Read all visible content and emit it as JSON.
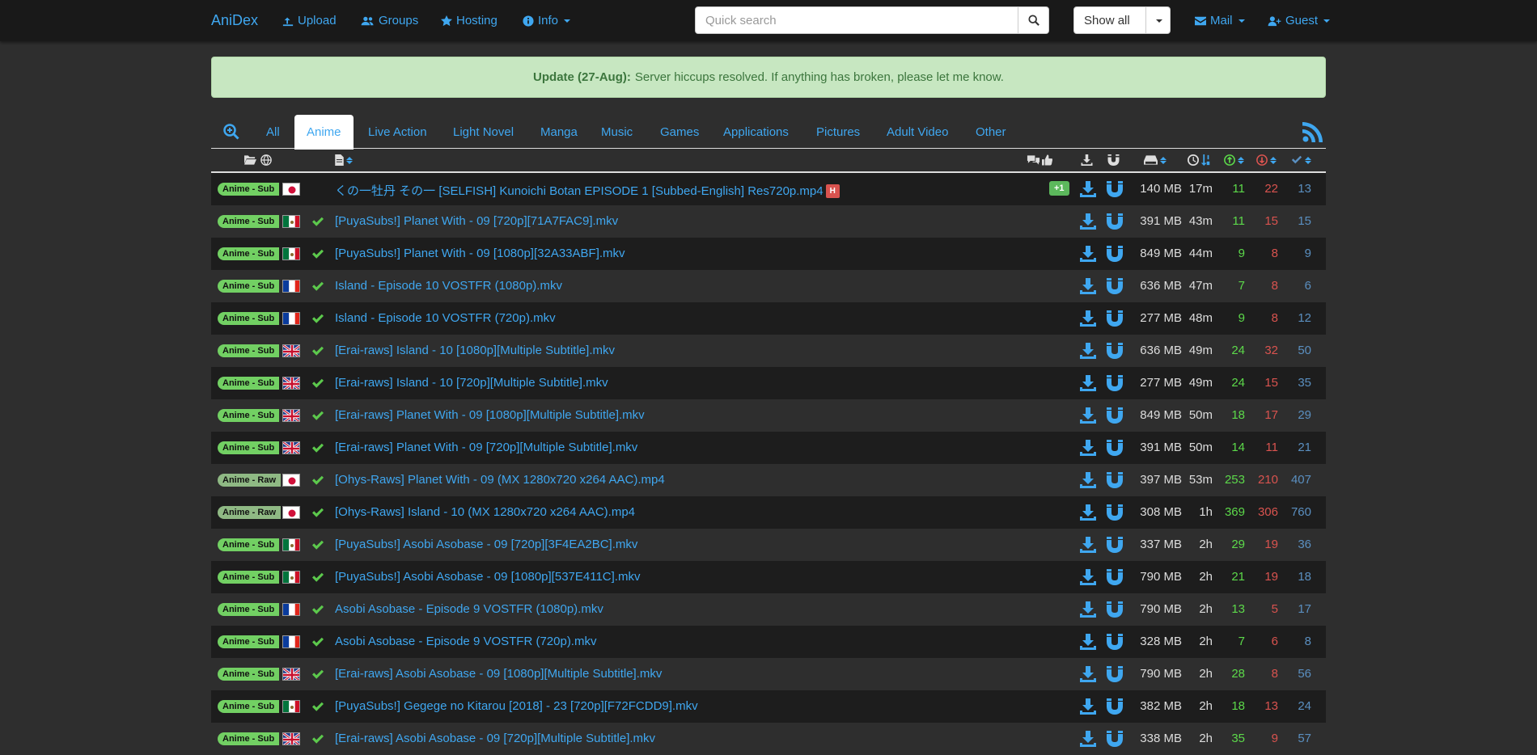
{
  "navbar": {
    "brand": "AniDex",
    "links": [
      {
        "label": "Upload",
        "icon": "upload-icon"
      },
      {
        "label": "Groups",
        "icon": "users-icon"
      },
      {
        "label": "Hosting",
        "icon": "star-icon"
      },
      {
        "label": "Info",
        "icon": "info-circle-icon"
      }
    ],
    "search_placeholder": "Quick search",
    "filter_label": "Show all",
    "mail_label": "Mail",
    "guest_label": "Guest"
  },
  "alert": {
    "title": "Update (27-Aug):",
    "message": "Server hiccups resolved. If anything has broken, please let me know."
  },
  "tabs": {
    "items": [
      "All",
      "Anime",
      "Live Action",
      "Light Novel",
      "Manga",
      "Music",
      "Games",
      "Applications",
      "Pictures",
      "Adult Video",
      "Other"
    ],
    "active": "Anime"
  },
  "rows": [
    {
      "cat": "Anime - Sub",
      "flag": "jp",
      "name": "くの一牡丹 その一 [SELFISH] Kunoichi Botan EPISODE 1 [Subbed-English] Res720p.mp4",
      "h": "H",
      "likes": "+1",
      "size": "140 MB",
      "age": "17m",
      "seed": "11",
      "leech": "22",
      "comp": "13"
    },
    {
      "cat": "Anime - Sub",
      "flag": "mx",
      "name": "[PuyaSubs!] Planet With - 09 [720p][71A7FAC9].mkv",
      "size": "391 MB",
      "age": "43m",
      "seed": "11",
      "leech": "15",
      "comp": "15"
    },
    {
      "cat": "Anime - Sub",
      "flag": "mx",
      "name": "[PuyaSubs!] Planet With - 09 [1080p][32A33ABF].mkv",
      "size": "849 MB",
      "age": "44m",
      "seed": "9",
      "leech": "8",
      "comp": "9"
    },
    {
      "cat": "Anime - Sub",
      "flag": "fr",
      "name": "Island - Episode 10 VOSTFR (1080p).mkv",
      "size": "636 MB",
      "age": "47m",
      "seed": "7",
      "leech": "8",
      "comp": "6"
    },
    {
      "cat": "Anime - Sub",
      "flag": "fr",
      "name": "Island - Episode 10 VOSTFR (720p).mkv",
      "size": "277 MB",
      "age": "48m",
      "seed": "9",
      "leech": "8",
      "comp": "12"
    },
    {
      "cat": "Anime - Sub",
      "flag": "gb",
      "name": "[Erai-raws] Island - 10 [1080p][Multiple Subtitle].mkv",
      "size": "636 MB",
      "age": "49m",
      "seed": "24",
      "leech": "32",
      "comp": "50"
    },
    {
      "cat": "Anime - Sub",
      "flag": "gb",
      "name": "[Erai-raws] Island - 10 [720p][Multiple Subtitle].mkv",
      "size": "277 MB",
      "age": "49m",
      "seed": "24",
      "leech": "15",
      "comp": "35"
    },
    {
      "cat": "Anime - Sub",
      "flag": "gb",
      "name": "[Erai-raws] Planet With - 09 [1080p][Multiple Subtitle].mkv",
      "size": "849 MB",
      "age": "50m",
      "seed": "18",
      "leech": "17",
      "comp": "29"
    },
    {
      "cat": "Anime - Sub",
      "flag": "gb",
      "name": "[Erai-raws] Planet With - 09 [720p][Multiple Subtitle].mkv",
      "size": "391 MB",
      "age": "50m",
      "seed": "14",
      "leech": "11",
      "comp": "21"
    },
    {
      "cat": "Anime - Raw",
      "flag": "jp",
      "name": "[Ohys-Raws] Planet With - 09 (MX 1280x720 x264 AAC).mp4",
      "size": "397 MB",
      "age": "53m",
      "seed": "253",
      "leech": "210",
      "comp": "407"
    },
    {
      "cat": "Anime - Raw",
      "flag": "jp",
      "name": "[Ohys-Raws] Island - 10 (MX 1280x720 x264 AAC).mp4",
      "size": "308 MB",
      "age": "1h",
      "seed": "369",
      "leech": "306",
      "comp": "760"
    },
    {
      "cat": "Anime - Sub",
      "flag": "mx",
      "name": "[PuyaSubs!] Asobi Asobase - 09 [720p][3F4EA2BC].mkv",
      "size": "337 MB",
      "age": "2h",
      "seed": "29",
      "leech": "19",
      "comp": "36"
    },
    {
      "cat": "Anime - Sub",
      "flag": "mx",
      "name": "[PuyaSubs!] Asobi Asobase - 09 [1080p][537E411C].mkv",
      "size": "790 MB",
      "age": "2h",
      "seed": "21",
      "leech": "19",
      "comp": "18"
    },
    {
      "cat": "Anime - Sub",
      "flag": "fr",
      "name": "Asobi Asobase - Episode 9 VOSTFR (1080p).mkv",
      "size": "790 MB",
      "age": "2h",
      "seed": "13",
      "leech": "5",
      "comp": "17"
    },
    {
      "cat": "Anime - Sub",
      "flag": "fr",
      "name": "Asobi Asobase - Episode 9 VOSTFR (720p).mkv",
      "size": "328 MB",
      "age": "2h",
      "seed": "7",
      "leech": "6",
      "comp": "8"
    },
    {
      "cat": "Anime - Sub",
      "flag": "gb",
      "name": "[Erai-raws] Asobi Asobase - 09 [1080p][Multiple Subtitle].mkv",
      "size": "790 MB",
      "age": "2h",
      "seed": "28",
      "leech": "8",
      "comp": "56"
    },
    {
      "cat": "Anime - Sub",
      "flag": "mx",
      "name": "[PuyaSubs!] Gegege no Kitarou [2018] - 23 [720p][F72FCDD9].mkv",
      "size": "382 MB",
      "age": "2h",
      "seed": "18",
      "leech": "13",
      "comp": "24"
    },
    {
      "cat": "Anime - Sub",
      "flag": "gb",
      "name": "[Erai-raws] Asobi Asobase - 09 [720p][Multiple Subtitle].mkv",
      "size": "338 MB",
      "age": "2h",
      "seed": "35",
      "leech": "9",
      "comp": "57"
    }
  ]
}
